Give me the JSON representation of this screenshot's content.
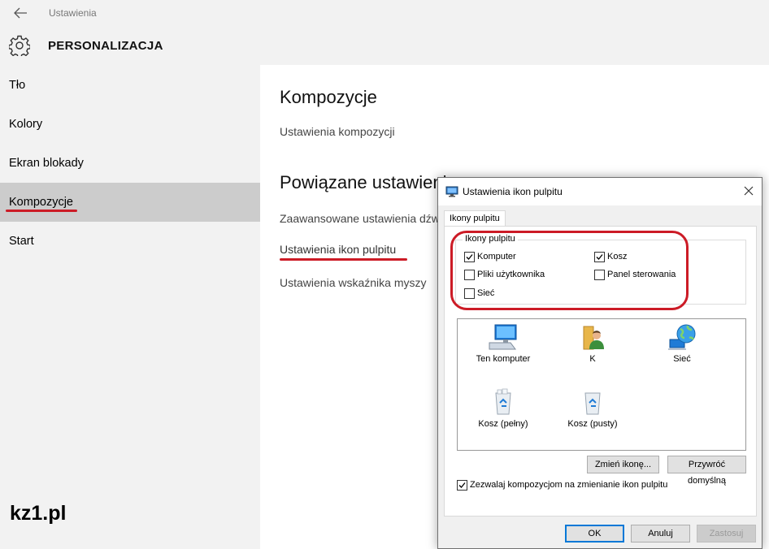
{
  "header": {
    "app_title": "Ustawienia",
    "section_title": "PERSONALIZACJA"
  },
  "sidebar": {
    "items": [
      {
        "label": "Tło"
      },
      {
        "label": "Kolory"
      },
      {
        "label": "Ekran blokady"
      },
      {
        "label": "Kompozycje",
        "selected": true
      },
      {
        "label": "Start"
      }
    ]
  },
  "brand": "kz1.pl",
  "main": {
    "heading": "Kompozycje",
    "themes_settings_link": "Ustawienia kompozycji",
    "related_heading": "Powiązane ustawienia",
    "related_links": [
      "Zaawansowane ustawienia dźwięku",
      "Ustawienia ikon pulpitu",
      "Ustawienia wskaźnika myszy"
    ]
  },
  "dialog": {
    "title": "Ustawienia ikon pulpitu",
    "tab_label": "Ikony pulpitu",
    "group_label": "Ikony pulpitu",
    "checkboxes": [
      {
        "label": "Komputer",
        "checked": true
      },
      {
        "label": "Kosz",
        "checked": true
      },
      {
        "label": "Pliki użytkownika",
        "checked": false
      },
      {
        "label": "Panel sterowania",
        "checked": false
      },
      {
        "label": "Sieć",
        "checked": false
      }
    ],
    "icons": [
      {
        "label": "Ten komputer",
        "icon": "computer-icon"
      },
      {
        "label": "K",
        "icon": "user-folder-icon"
      },
      {
        "label": "Sieć",
        "icon": "network-globe-icon"
      },
      {
        "label": "Kosz (pełny)",
        "icon": "recycle-bin-full-icon"
      },
      {
        "label": "Kosz (pusty)",
        "icon": "recycle-bin-empty-icon"
      }
    ],
    "change_icon_button": "Zmień ikonę...",
    "restore_default_button": "Przywróć domyślną",
    "allow_themes_checkbox": {
      "label": "Zezwalaj kompozycjom na zmienianie ikon pulpitu",
      "checked": true
    },
    "ok_button": "OK",
    "cancel_button": "Anuluj",
    "apply_button": "Zastosuj"
  },
  "colors": {
    "sidebar_bg": "#f2f2f2",
    "selected_bg": "#cccccc",
    "annotation_red": "#cc1b26",
    "primary_button_border": "#0078d7"
  }
}
